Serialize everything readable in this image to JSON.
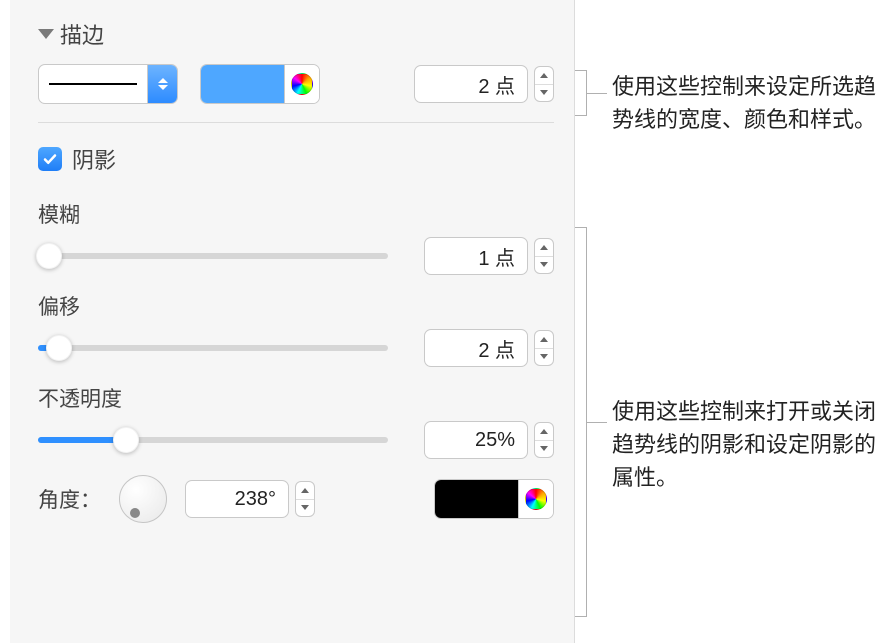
{
  "stroke": {
    "title": "描边",
    "width_value": "2 点"
  },
  "shadow": {
    "label": "阴影",
    "checked": true,
    "blur": {
      "label": "模糊",
      "value": "1 点",
      "percent": 3
    },
    "offset": {
      "label": "偏移",
      "value": "2 点",
      "percent": 6
    },
    "opacity": {
      "label": "不透明度",
      "value": "25%",
      "percent": 25
    },
    "angle": {
      "label": "角度：",
      "value": "238°"
    }
  },
  "colors": {
    "stroke_swatch": "#4ea7ff",
    "shadow_swatch": "#000000"
  },
  "callouts": {
    "c1": "使用这些控制来设定所选趋势线的宽度、颜色和样式。",
    "c2": "使用这些控制来打开或关闭趋势线的阴影和设定阴影的属性。"
  }
}
